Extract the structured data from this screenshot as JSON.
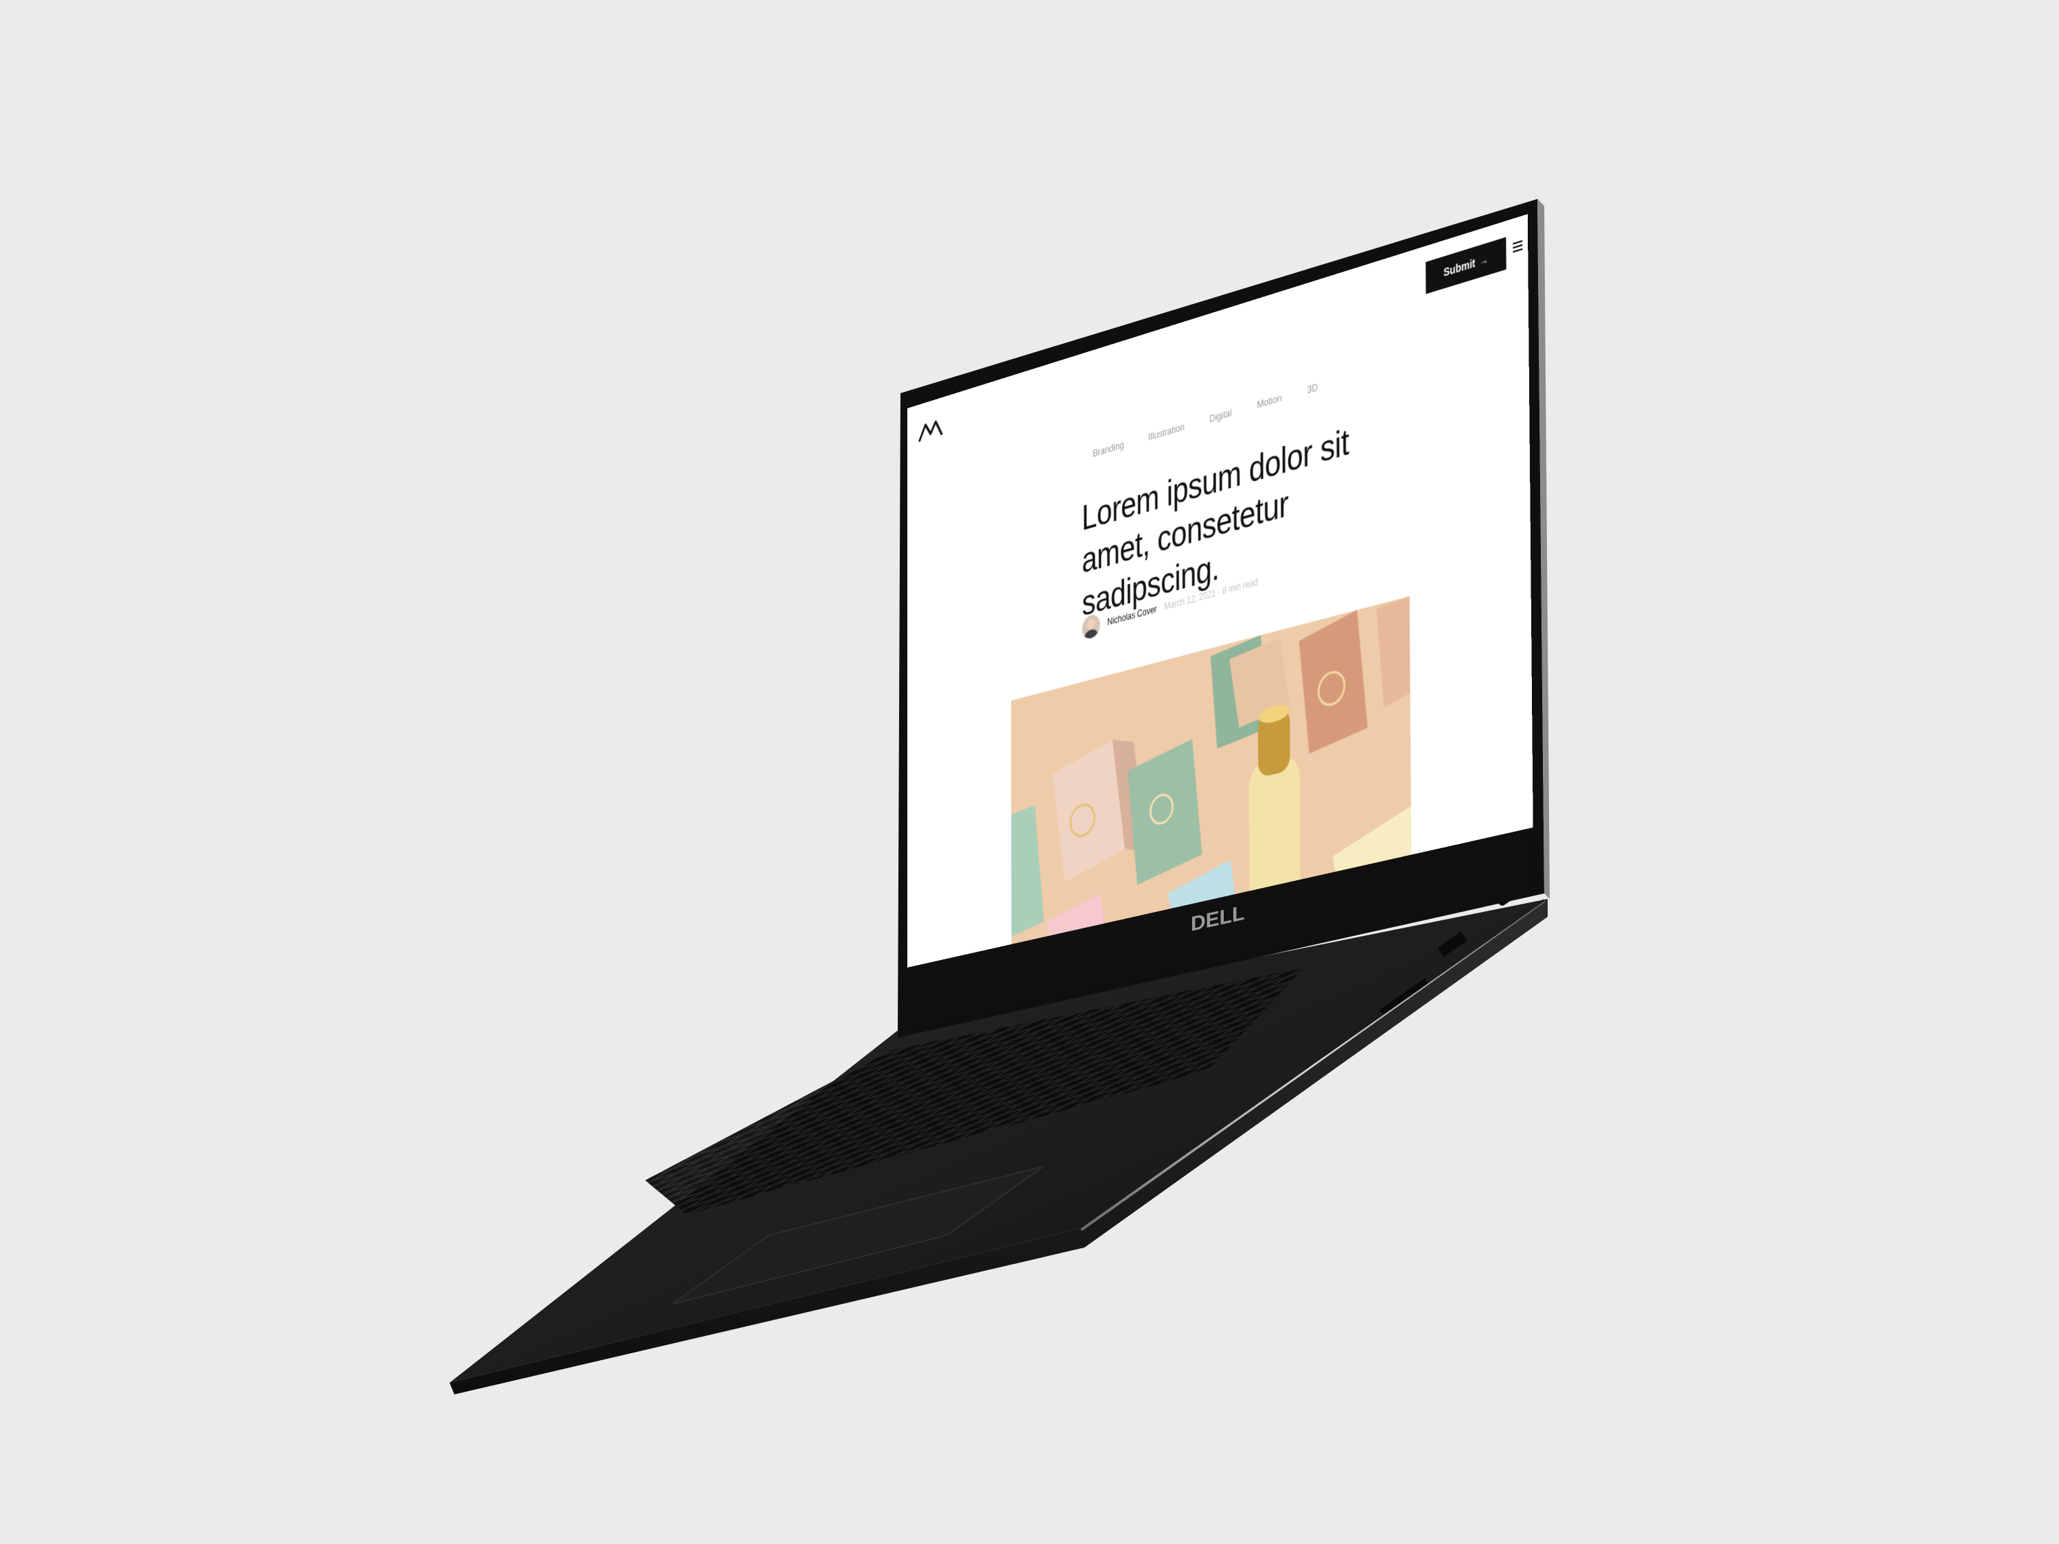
{
  "device": {
    "brand_logo": "DELL"
  },
  "site": {
    "logo_icon": "brand-logo-icon",
    "submit_label": "Submit",
    "submit_icon": "arrow-right-icon",
    "menu_icon": "hamburger-menu-icon",
    "nav": [
      {
        "label": "Branding"
      },
      {
        "label": "Illustration"
      },
      {
        "label": "Digital"
      },
      {
        "label": "Motion"
      },
      {
        "label": "3D"
      }
    ]
  },
  "post": {
    "title": "Lorem ipsum dolor sit amet, consetetur sadipscing.",
    "author": "Nicholas Cover",
    "meta": "March 12, 2021 · 8 min read",
    "image_alt_icon": "product-packaging-photo"
  },
  "colors": {
    "background": "#ebebeb",
    "laptop_body": "#161616",
    "screen_bg": "#ffffff",
    "accent_button": "#111111"
  }
}
